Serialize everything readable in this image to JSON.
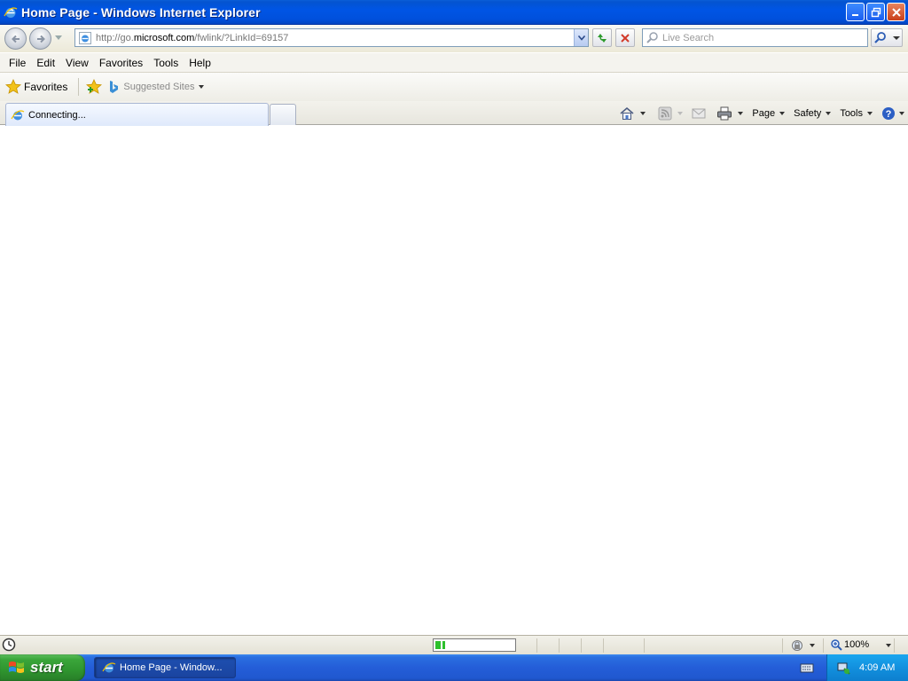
{
  "window": {
    "title": "Home Page - Windows Internet Explorer"
  },
  "address": {
    "url_prefix": "http://go.",
    "url_domain": "microsoft.com",
    "url_path": "/fwlink/?LinkId=69157"
  },
  "search": {
    "placeholder": "Live Search"
  },
  "menu": {
    "items": [
      "File",
      "Edit",
      "View",
      "Favorites",
      "Tools",
      "Help"
    ]
  },
  "favorites_bar": {
    "favorites_label": "Favorites",
    "suggested_label": "Suggested Sites"
  },
  "tab": {
    "label": "Connecting..."
  },
  "command_bar": {
    "page_label": "Page",
    "safety_label": "Safety",
    "tools_label": "Tools"
  },
  "status": {
    "zoom": "100%",
    "progress": 0.12
  },
  "taskbar": {
    "start_label": "start",
    "task_label": "Home Page - Window...",
    "clock": "4:09 AM"
  },
  "colors": {
    "titlebar": "#0055e5",
    "taskbar": "#245dd8",
    "start": "#3aa53a",
    "tray": "#1290de"
  }
}
